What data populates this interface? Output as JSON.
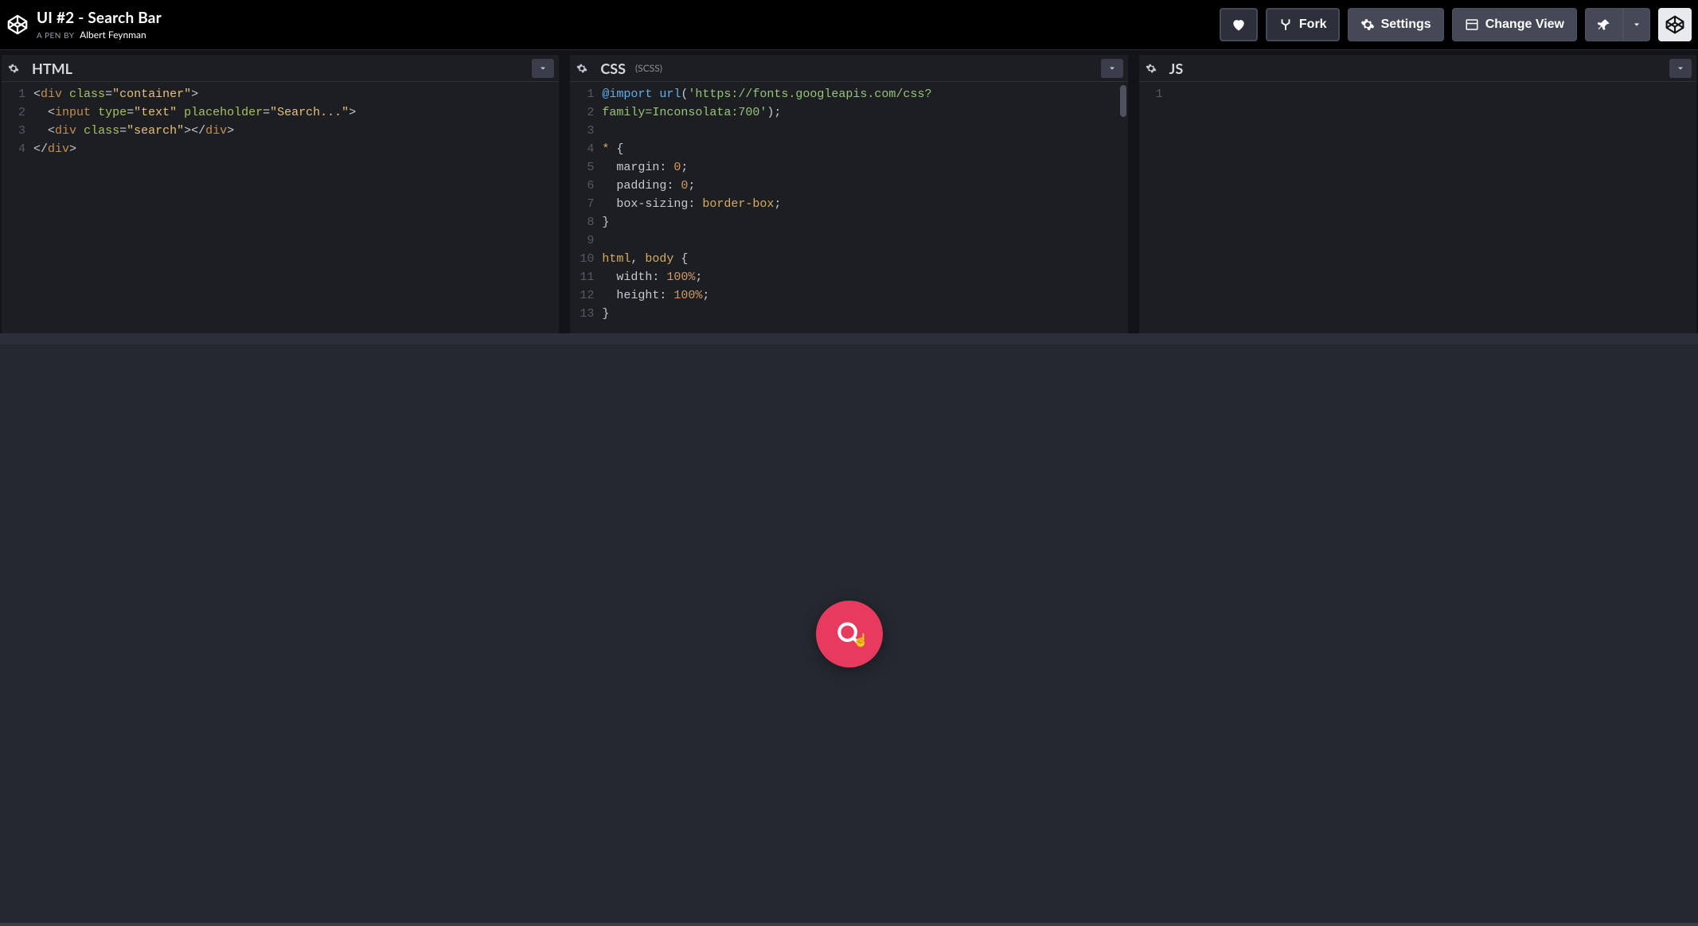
{
  "header": {
    "pen_title": "UI #2 - Search Bar",
    "byline_label": "A PEN BY",
    "author": "Albert Feynman",
    "buttons": {
      "fork": "Fork",
      "settings": "Settings",
      "change_view": "Change View"
    }
  },
  "panels": {
    "html": {
      "title": "HTML",
      "subtitle": "",
      "line_numbers": [
        "1",
        "2",
        "3",
        "4"
      ],
      "code_tokens": [
        [
          [
            "<",
            "t-pun"
          ],
          [
            "div",
            "t-tag"
          ],
          [
            " ",
            "t-pun"
          ],
          [
            "class",
            "t-attr"
          ],
          [
            "=",
            "t-pun"
          ],
          [
            "\"container\"",
            "t-str"
          ],
          [
            ">",
            "t-pun"
          ]
        ],
        [
          [
            "  ",
            "t-pun"
          ],
          [
            "<",
            "t-pun"
          ],
          [
            "input",
            "t-tag"
          ],
          [
            " ",
            "t-pun"
          ],
          [
            "type",
            "t-attr"
          ],
          [
            "=",
            "t-pun"
          ],
          [
            "\"text\"",
            "t-str"
          ],
          [
            " ",
            "t-pun"
          ],
          [
            "placeholder",
            "t-attr"
          ],
          [
            "=",
            "t-pun"
          ],
          [
            "\"Search...\"",
            "t-str"
          ],
          [
            ">",
            "t-pun"
          ]
        ],
        [
          [
            "  ",
            "t-pun"
          ],
          [
            "<",
            "t-pun"
          ],
          [
            "div",
            "t-tag"
          ],
          [
            " ",
            "t-pun"
          ],
          [
            "class",
            "t-attr"
          ],
          [
            "=",
            "t-pun"
          ],
          [
            "\"search\"",
            "t-str"
          ],
          [
            "></",
            "t-pun"
          ],
          [
            "div",
            "t-tag"
          ],
          [
            ">",
            "t-pun"
          ]
        ],
        [
          [
            "</",
            "t-pun"
          ],
          [
            "div",
            "t-tag"
          ],
          [
            ">",
            "t-pun"
          ]
        ]
      ]
    },
    "css": {
      "title": "CSS",
      "subtitle": "(SCSS)",
      "line_numbers": [
        "1",
        "2",
        "3",
        "4",
        "5",
        "6",
        "7",
        "8",
        "9",
        "10",
        "11",
        "12",
        "13"
      ],
      "code_tokens": [
        [
          [
            "@import",
            "t-imp"
          ],
          [
            " ",
            "t-pun"
          ],
          [
            "url",
            "t-func"
          ],
          [
            "(",
            "t-pun"
          ],
          [
            "'https://fonts.googleapis.com/css?",
            "t-url"
          ]
        ],
        [
          [
            "family=Inconsolata:700'",
            "t-url"
          ],
          [
            ")",
            "t-pun"
          ],
          [
            ";",
            "t-pun"
          ]
        ],
        [],
        [
          [
            "*",
            "t-sel"
          ],
          [
            " {",
            "t-pun"
          ]
        ],
        [
          [
            "  margin",
            "t-prop"
          ],
          [
            ": ",
            "t-pun"
          ],
          [
            "0",
            "t-num"
          ],
          [
            ";",
            "t-pun"
          ]
        ],
        [
          [
            "  padding",
            "t-prop"
          ],
          [
            ": ",
            "t-pun"
          ],
          [
            "0",
            "t-num"
          ],
          [
            ";",
            "t-pun"
          ]
        ],
        [
          [
            "  box-sizing",
            "t-prop"
          ],
          [
            ": ",
            "t-pun"
          ],
          [
            "border-box",
            "t-sel"
          ],
          [
            ";",
            "t-pun"
          ]
        ],
        [
          [
            "}",
            "t-pun"
          ]
        ],
        [],
        [
          [
            "html",
            "t-sel"
          ],
          [
            ", ",
            "t-pun"
          ],
          [
            "body",
            "t-sel"
          ],
          [
            " {",
            "t-pun"
          ]
        ],
        [
          [
            "  width",
            "t-prop"
          ],
          [
            ": ",
            "t-pun"
          ],
          [
            "100%",
            "t-num"
          ],
          [
            ";",
            "t-pun"
          ]
        ],
        [
          [
            "  height",
            "t-prop"
          ],
          [
            ": ",
            "t-pun"
          ],
          [
            "100%",
            "t-num"
          ],
          [
            ";",
            "t-pun"
          ]
        ],
        [
          [
            "}",
            "t-pun"
          ]
        ]
      ]
    },
    "js": {
      "title": "JS",
      "subtitle": "",
      "line_numbers": [
        "1"
      ],
      "code_tokens": [
        []
      ]
    }
  },
  "preview": {
    "search_button_color": "#e8395f"
  }
}
